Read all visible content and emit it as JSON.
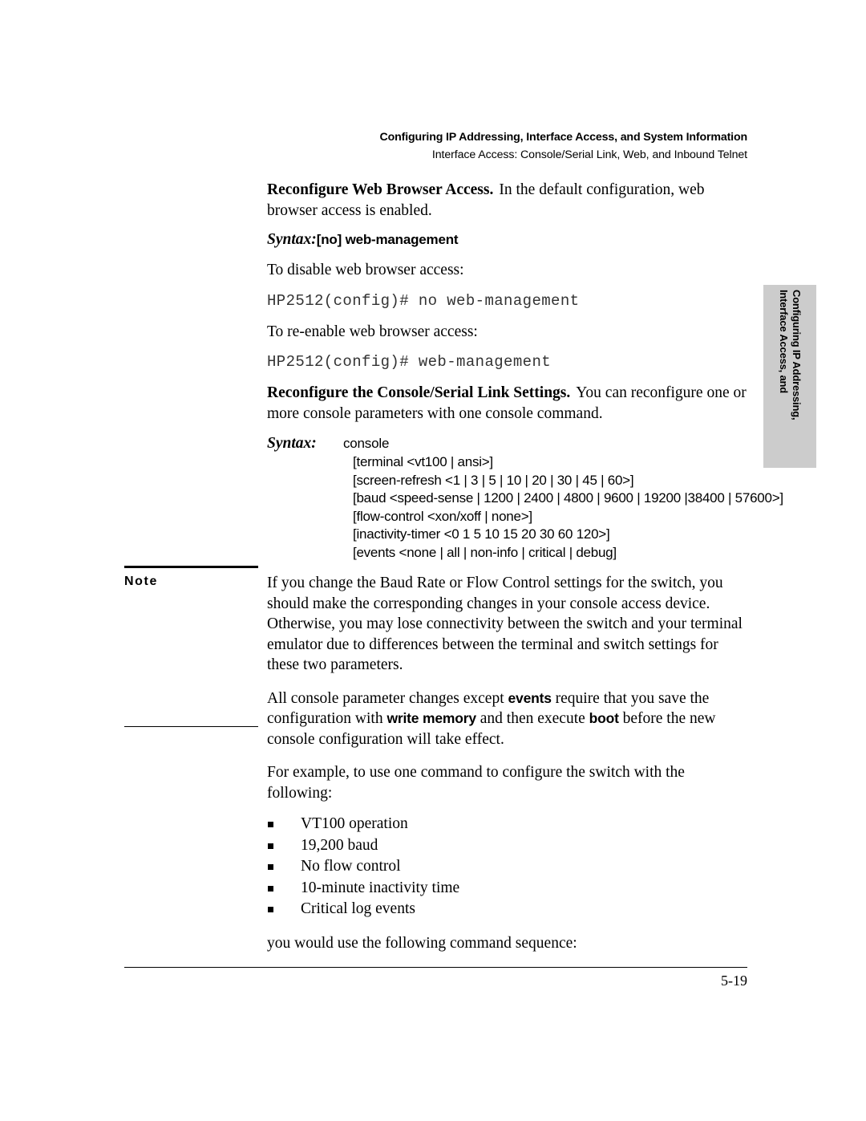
{
  "header": {
    "line1": "Configuring IP Addressing, Interface Access, and System Information",
    "line2": "Interface Access: Console/Serial Link, Web, and Inbound Telnet"
  },
  "side_tab": {
    "line1": "Configuring IP Addressing,",
    "line2": "Interface Access, and",
    "background_color": "#cccccc"
  },
  "web_browser_section": {
    "heading": "Reconfigure Web Browser Access.",
    "intro": "In the default configuration, web browser access is enabled.",
    "syntax_label": "Syntax:",
    "syntax_value": "[no] web-management",
    "disable_text": "To disable web browser access:",
    "disable_command": "HP2512(config)# no web-management",
    "reenable_text": "To re-enable web browser access:",
    "reenable_command": "HP2512(config)# web-management"
  },
  "console_section": {
    "heading": "Reconfigure the Console/Serial Link Settings.",
    "intro": "You can reconfigure one or more console parameters with one console command.",
    "syntax_label": "Syntax:",
    "syntax_command": "console",
    "syntax_options": [
      "[terminal <vt100 | ansi>]",
      "[screen-refresh <1 | 3 | 5 | 10 | 20 | 30 | 45 | 60>]",
      "[baud <speed-sense | 1200 | 2400 |  4800 | 9600 | 19200 |38400 | 57600>]",
      "[flow-control <xon/xoff | none>]",
      "[inactivity-timer <0  1  5  10  15  20  30  60  120>]",
      "[events <none | all | non-info | critical | debug]"
    ]
  },
  "note": {
    "label": "Note",
    "paragraph": "If you change the Baud Rate or Flow Control settings for the switch, you should make the corresponding changes in your console access device. Otherwise, you may lose connectivity between the switch and your terminal emulator due to differences between the terminal and switch settings for these two parameters."
  },
  "save_paragraph": {
    "part1": "All console parameter changes except ",
    "cmd1": "events",
    "part2": " require that you save the configuration with ",
    "cmd2": "write memory",
    "part3": " and then execute ",
    "cmd3": "boot",
    "part4": " before the new console configuration will take effect."
  },
  "example": {
    "intro": "For example, to use one command to configure the switch with the following:",
    "bullets": [
      "VT100 operation",
      "19,200 baud",
      "No flow control",
      "10-minute inactivity time",
      "Critical log events"
    ],
    "closing": "you would use the following command sequence:"
  },
  "footer": {
    "page_number": "5-19"
  }
}
